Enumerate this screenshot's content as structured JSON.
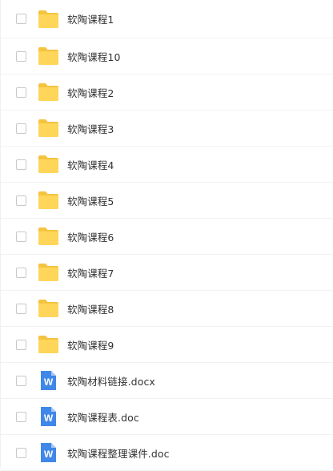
{
  "colors": {
    "folder_body": "#FFD659",
    "folder_tab": "#F5C340",
    "word_blue": "#3F87E8",
    "word_fold": "#A8C8F5",
    "text": "#333333"
  },
  "files": [
    {
      "name": "软陶课程1",
      "icon": "folder-icon"
    },
    {
      "name": "软陶课程10",
      "icon": "folder-icon"
    },
    {
      "name": "软陶课程2",
      "icon": "folder-icon"
    },
    {
      "name": "软陶课程3",
      "icon": "folder-icon"
    },
    {
      "name": "软陶课程4",
      "icon": "folder-icon"
    },
    {
      "name": "软陶课程5",
      "icon": "folder-icon"
    },
    {
      "name": "软陶课程6",
      "icon": "folder-icon"
    },
    {
      "name": "软陶课程7",
      "icon": "folder-icon"
    },
    {
      "name": "软陶课程8",
      "icon": "folder-icon"
    },
    {
      "name": "软陶课程9",
      "icon": "folder-icon"
    },
    {
      "name": "软陶材料链接.docx",
      "icon": "word-doc-icon",
      "badge": "W"
    },
    {
      "name": "软陶课程表.doc",
      "icon": "word-doc-icon",
      "badge": "W"
    },
    {
      "name": "软陶课程整理课件.doc",
      "icon": "word-doc-icon",
      "badge": "W"
    }
  ]
}
